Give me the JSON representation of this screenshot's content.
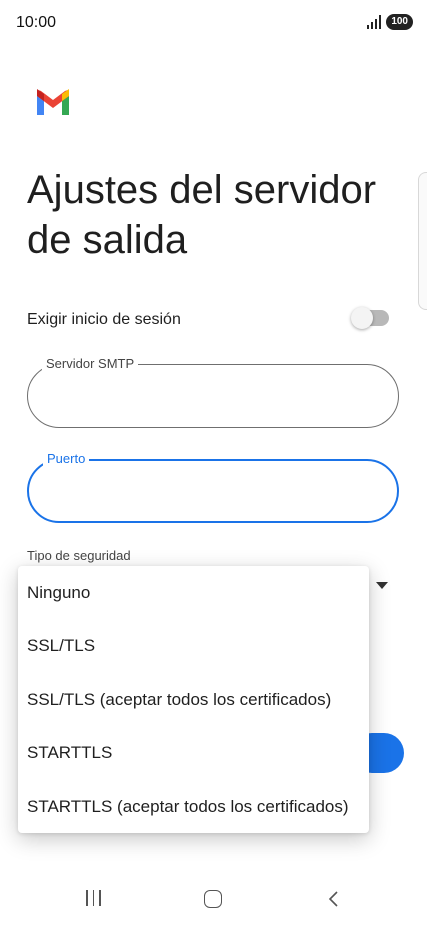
{
  "status_bar": {
    "time": "10:00",
    "battery": "100"
  },
  "page": {
    "title": "Ajustes del servidor de salida"
  },
  "login": {
    "label": "Exigir inicio de sesión",
    "enabled": false
  },
  "smtp_field": {
    "label": "Servidor SMTP",
    "value": ""
  },
  "port_field": {
    "label": "Puerto",
    "value": ""
  },
  "security": {
    "label": "Tipo de seguridad",
    "options": [
      "Ninguno",
      "SSL/TLS",
      "SSL/TLS (aceptar todos los certificados)",
      "STARTTLS",
      "STARTTLS (aceptar todos los certificados)"
    ]
  },
  "colors": {
    "accent": "#1a73e8",
    "gmail_red": "#ea4335",
    "gmail_blue": "#4285f4",
    "gmail_green": "#34a853",
    "gmail_yellow": "#fbbc04"
  }
}
